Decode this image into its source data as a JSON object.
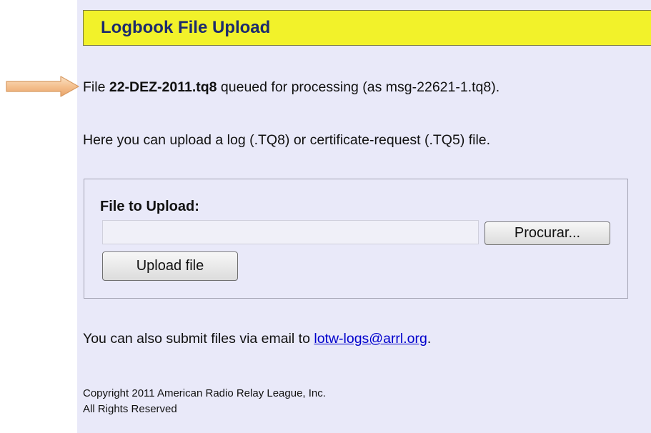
{
  "header": {
    "title": "Logbook File Upload"
  },
  "status": {
    "prefix": "File ",
    "filename": "22-DEZ-2011.tq8",
    "suffix": " queued for processing (as msg-22621-1.tq8)."
  },
  "info_text": "Here you can upload a log (.TQ8) or certificate-request (.TQ5) file.",
  "upload_form": {
    "label": "File to Upload:",
    "file_value": "",
    "browse_label": "Procurar...",
    "submit_label": "Upload file"
  },
  "email": {
    "prefix": "You can also submit files via email to ",
    "link_text": "lotw-logs@arrl.org",
    "suffix": "."
  },
  "footer": {
    "copyright": "Copyright 2011 American Radio Relay League, Inc.",
    "rights": "All Rights Reserved"
  },
  "colors": {
    "panel_bg": "#e9e9f9",
    "header_bg": "#f2f22a",
    "header_text": "#1c2a6e",
    "link": "#0000cc",
    "arrow_fill": "#f6c79e"
  },
  "icons": {
    "annotation": "right-arrow-icon"
  }
}
